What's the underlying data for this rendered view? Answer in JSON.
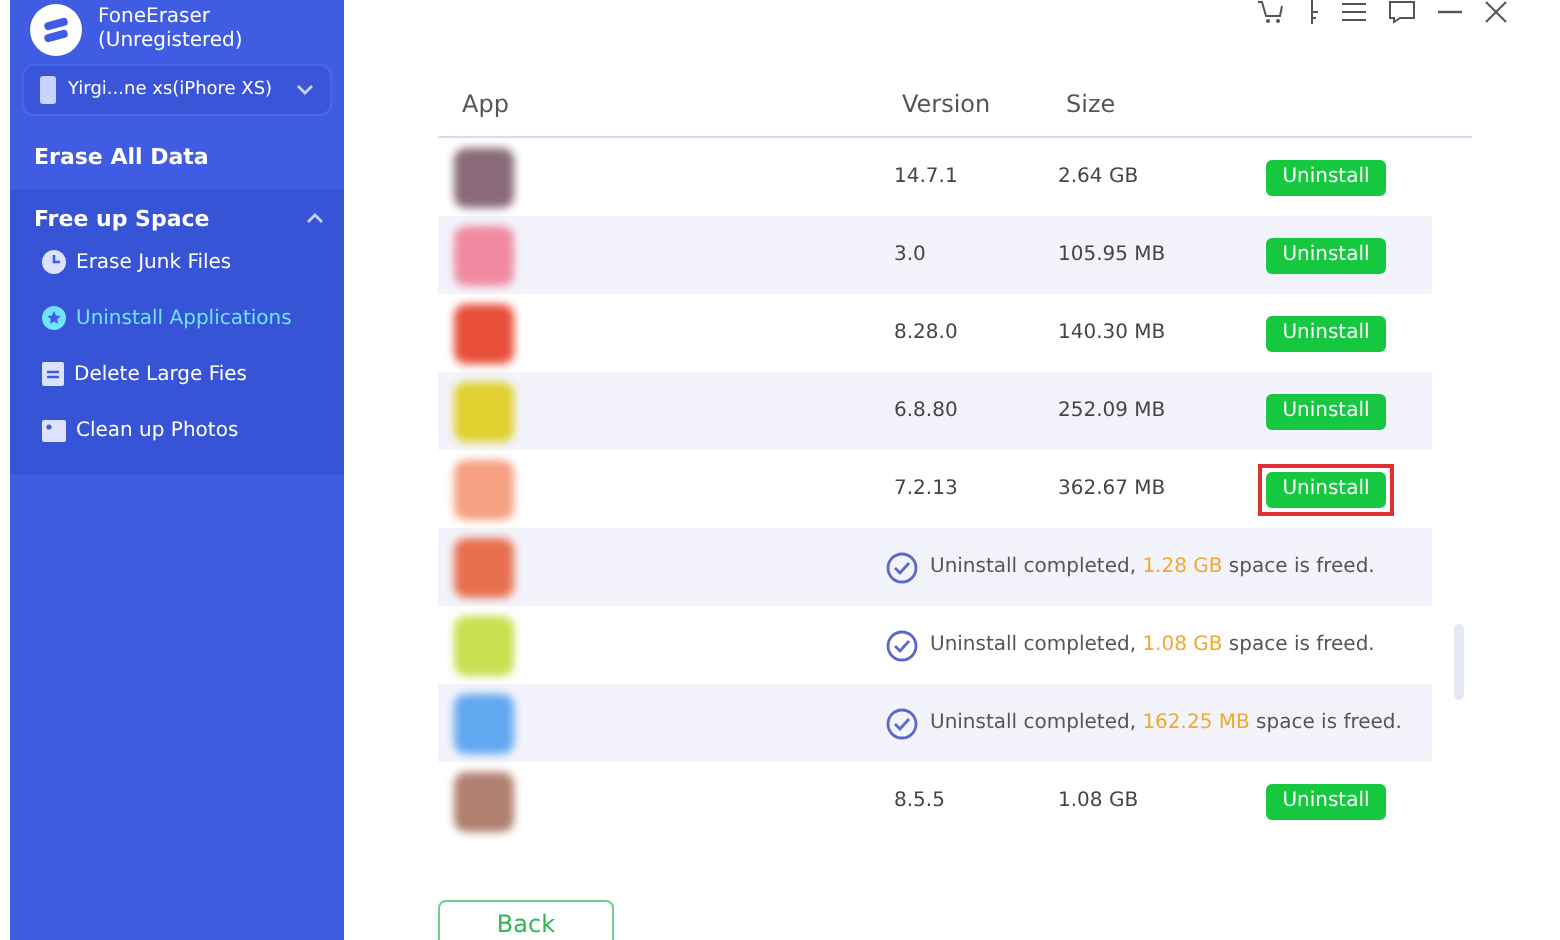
{
  "app": {
    "title": "FoneEraser",
    "subtitle": "(Unregistered)"
  },
  "device": {
    "label": "Yirgi...ne xs(iPhore XS)"
  },
  "sidebar": {
    "top_item": "Erase All Data",
    "section": {
      "title": "Free up Space",
      "expanded": true,
      "items": [
        {
          "label": "Erase Junk Files",
          "selected": false
        },
        {
          "label": "Uninstall Applications",
          "selected": true
        },
        {
          "label": "Delete Large Fies",
          "selected": false
        },
        {
          "label": "Clean up Photos",
          "selected": false
        }
      ]
    }
  },
  "table": {
    "columns": [
      "App",
      "Version",
      "Size"
    ],
    "rows": [
      {
        "kind": "app",
        "color": "#8a6a78",
        "version": "14.7.1",
        "size": "2.64 GB",
        "button": "Uninstall",
        "highlighted": false
      },
      {
        "kind": "app",
        "color": "#f08aa0",
        "version": "3.0",
        "size": "105.95 MB",
        "button": "Uninstall",
        "highlighted": false
      },
      {
        "kind": "app",
        "color": "#e8503a",
        "version": "8.28.0",
        "size": "140.30 MB",
        "button": "Uninstall",
        "highlighted": false
      },
      {
        "kind": "app",
        "color": "#e0d030",
        "version": "6.8.80",
        "size": "252.09 MB",
        "button": "Uninstall",
        "highlighted": false
      },
      {
        "kind": "app",
        "color": "#f5a080",
        "version": "7.2.13",
        "size": "362.67 MB",
        "button": "Uninstall",
        "highlighted": true
      },
      {
        "kind": "done",
        "color": "#e87050",
        "message": "Uninstall completed, **1.28 GB** space is freed."
      },
      {
        "kind": "done",
        "color": "#c8e050",
        "message": "Uninstall completed, **1.08 GB** space is freed."
      },
      {
        "kind": "done",
        "color": "#60a8f0",
        "message": "Uninstall completed, **162.25 MB** space is freed."
      },
      {
        "kind": "app",
        "color": "#b08070",
        "version": "8.5.5",
        "size": "1.08 GB",
        "button": "Uninstall",
        "highlighted": false
      }
    ]
  },
  "back_button": "Back"
}
